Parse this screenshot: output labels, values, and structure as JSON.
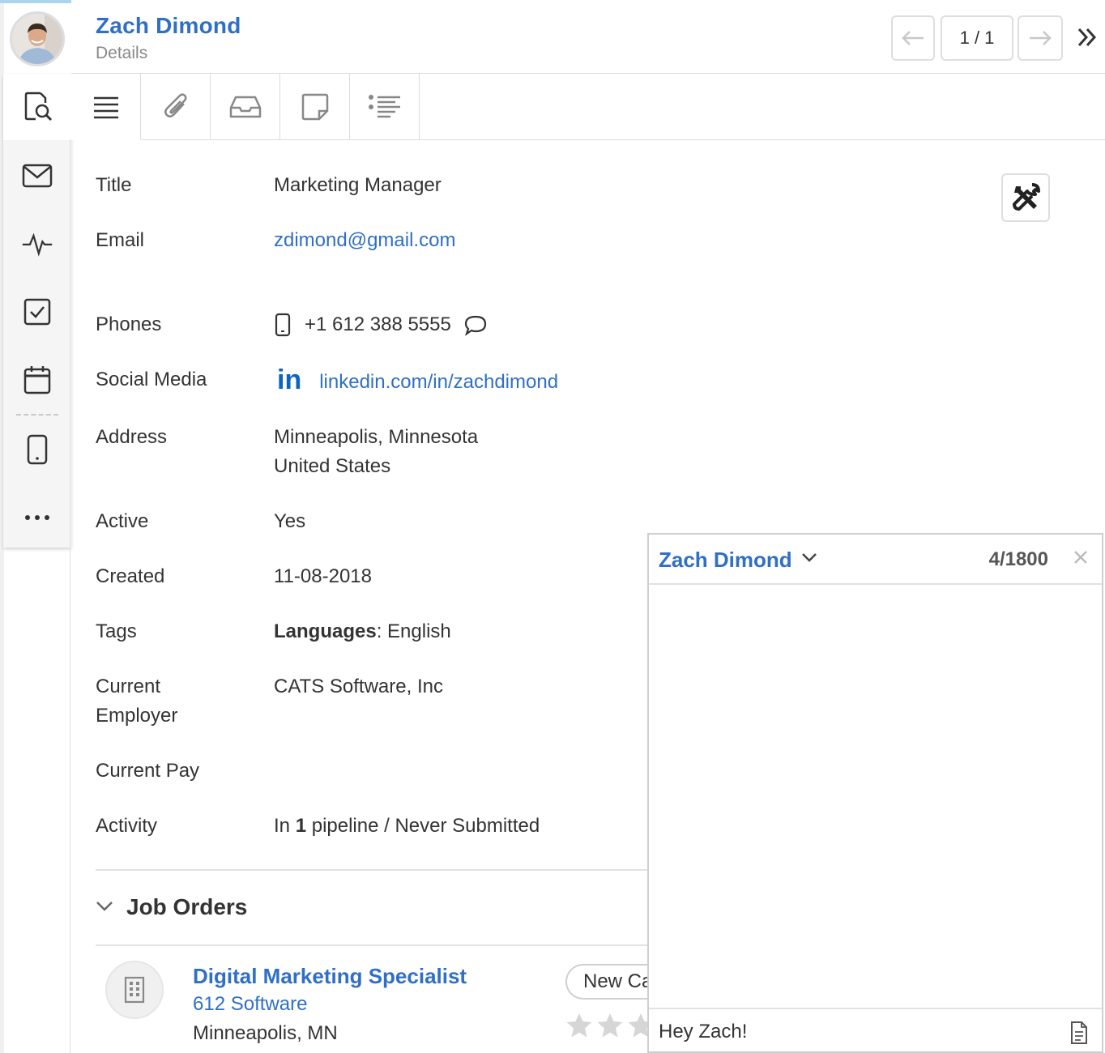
{
  "header": {
    "name": "Zach Dimond",
    "subtitle": "Details",
    "pager": "1 / 1"
  },
  "details": {
    "title": {
      "label": "Title",
      "value": "Marketing Manager"
    },
    "email": {
      "label": "Email",
      "value": "zdimond@gmail.com"
    },
    "phones": {
      "label": "Phones",
      "value": "+1 612 388 5555"
    },
    "social": {
      "label": "Social Media",
      "value": "linkedin.com/in/zachdimond",
      "network": "in"
    },
    "address": {
      "label": "Address",
      "line1": "Minneapolis, Minnesota",
      "line2": "United States"
    },
    "active": {
      "label": "Active",
      "value": "Yes"
    },
    "created": {
      "label": "Created",
      "value": "11-08-2018"
    },
    "tags": {
      "label": "Tags",
      "key": "Languages",
      "value": ": English"
    },
    "employer": {
      "label_line1": "Current",
      "label_line2": "Employer",
      "value": "CATS Software, Inc"
    },
    "pay": {
      "label": "Current Pay"
    },
    "activity": {
      "label": "Activity",
      "prefix": "In ",
      "count": "1",
      "suffix": " pipeline / Never Submitted"
    }
  },
  "job_orders": {
    "section_title": "Job Orders",
    "items": [
      {
        "title": "Digital Marketing Specialist",
        "company": "612 Software",
        "location": "Minneapolis, MN",
        "status": "New Candidate",
        "rating": 0
      }
    ]
  },
  "chat": {
    "recipient": "Zach Dimond",
    "char_count": "4/1800",
    "message": "Hey Zach!"
  },
  "colors": {
    "link": "#2f6fc6",
    "linkedin": "#0a66c2",
    "border": "#dcdcdc"
  }
}
